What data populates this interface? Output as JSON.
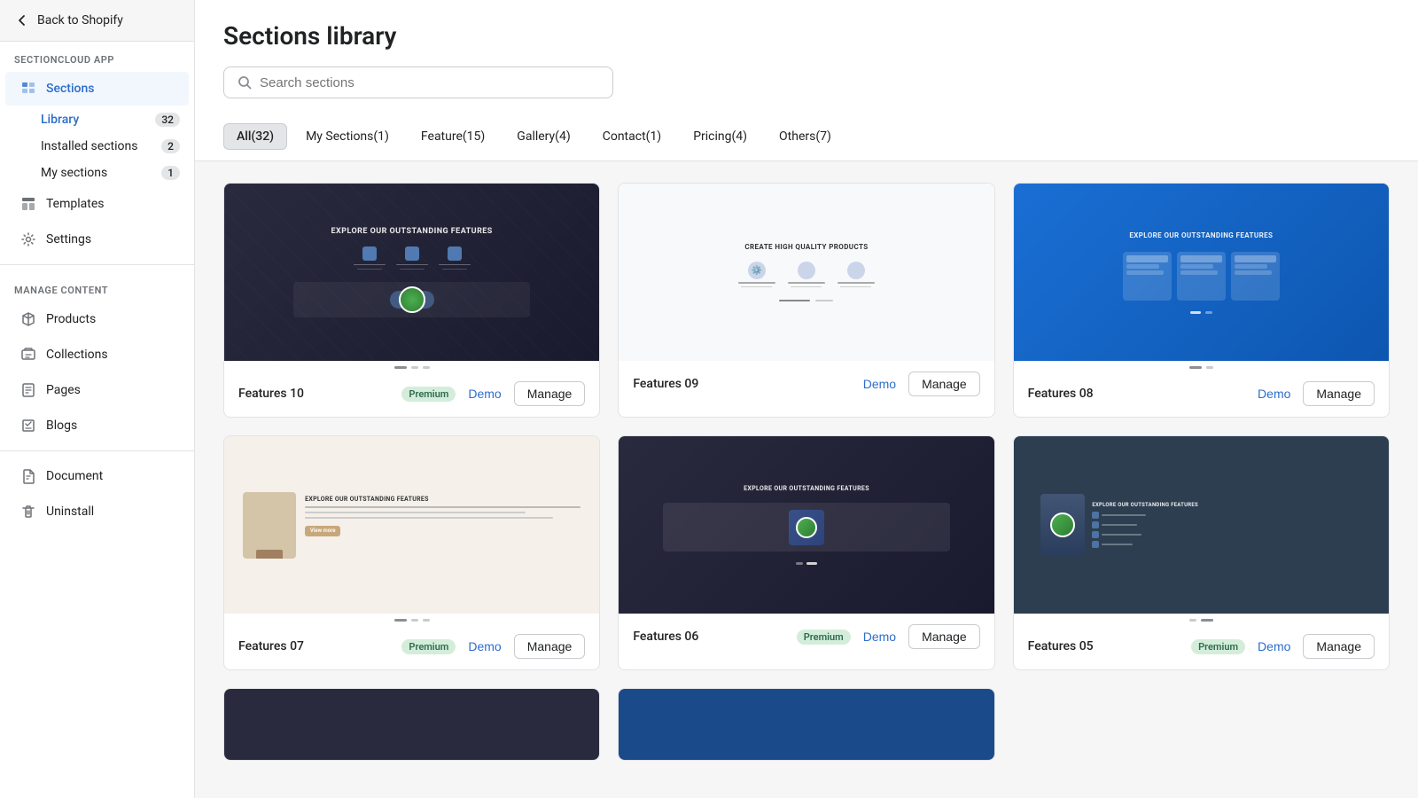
{
  "app": {
    "back_label": "Back to Shopify",
    "app_label": "SECTIONCLOUD APP"
  },
  "sidebar": {
    "sections_label": "Sections",
    "sub_items": [
      {
        "id": "library",
        "label": "Library",
        "badge": 32,
        "active": true
      },
      {
        "id": "installed",
        "label": "Installed sections",
        "badge": 2,
        "active": false
      },
      {
        "id": "my-sections",
        "label": "My sections",
        "badge": 1,
        "active": false
      }
    ],
    "templates_label": "Templates",
    "settings_label": "Settings",
    "manage_content_label": "MANAGE CONTENT",
    "manage_items": [
      {
        "id": "products",
        "label": "Products"
      },
      {
        "id": "collections",
        "label": "Collections"
      },
      {
        "id": "pages",
        "label": "Pages"
      },
      {
        "id": "blogs",
        "label": "Blogs"
      }
    ],
    "bottom_items": [
      {
        "id": "document",
        "label": "Document"
      },
      {
        "id": "uninstall",
        "label": "Uninstall"
      }
    ]
  },
  "main": {
    "title": "Sections library",
    "search_placeholder": "Search sections",
    "filters": [
      {
        "id": "all",
        "label": "All(32)",
        "active": true
      },
      {
        "id": "my-sections",
        "label": "My Sections(1)",
        "active": false
      },
      {
        "id": "feature",
        "label": "Feature(15)",
        "active": false
      },
      {
        "id": "gallery",
        "label": "Gallery(4)",
        "active": false
      },
      {
        "id": "contact",
        "label": "Contact(1)",
        "active": false
      },
      {
        "id": "pricing",
        "label": "Pricing(4)",
        "active": false
      },
      {
        "id": "others",
        "label": "Others(7)",
        "active": false
      }
    ],
    "cards": [
      {
        "id": "features10",
        "name": "Features 10",
        "premium": true,
        "demo_label": "Demo",
        "manage_label": "Manage",
        "img_class": "img-features10",
        "dots": [
          true,
          false,
          false
        ]
      },
      {
        "id": "features09",
        "name": "Features 09",
        "premium": false,
        "demo_label": "Demo",
        "manage_label": "Manage",
        "img_class": "img-features09",
        "dots": [
          true,
          false
        ]
      },
      {
        "id": "features08",
        "name": "Features 08",
        "premium": false,
        "demo_label": "Demo",
        "manage_label": "Manage",
        "img_class": "img-features08",
        "dots": [
          true,
          false
        ]
      },
      {
        "id": "features07",
        "name": "Features 07",
        "premium": true,
        "demo_label": "Demo",
        "manage_label": "Manage",
        "img_class": "img-features07",
        "dots": [
          true,
          false,
          false
        ]
      },
      {
        "id": "features06",
        "name": "Features 06",
        "premium": true,
        "demo_label": "Demo",
        "manage_label": "Manage",
        "img_class": "img-features06",
        "dots": [
          false,
          true
        ]
      },
      {
        "id": "features05",
        "name": "Features 05",
        "premium": true,
        "demo_label": "Demo",
        "manage_label": "Manage",
        "img_class": "img-features05",
        "dots": [
          false,
          true
        ]
      }
    ]
  }
}
